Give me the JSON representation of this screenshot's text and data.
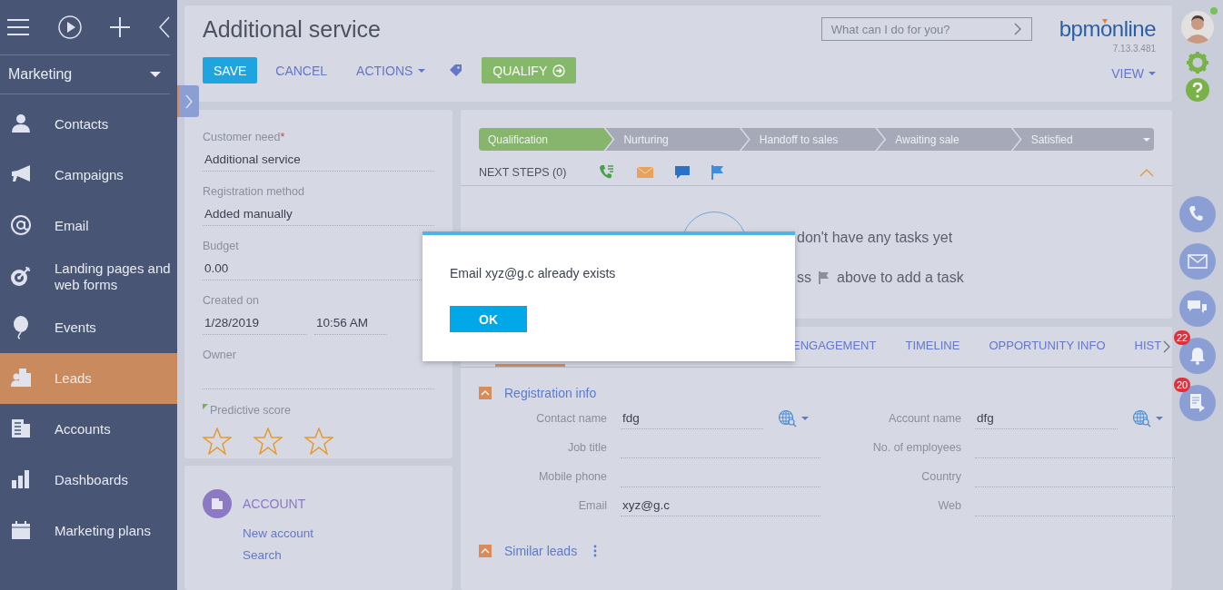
{
  "sidebar": {
    "workspace": "Marketing",
    "items": [
      {
        "label": "Contacts",
        "selected": false
      },
      {
        "label": "Campaigns",
        "selected": false
      },
      {
        "label": "Email",
        "selected": false
      },
      {
        "label": "Landing pages and web forms",
        "selected": false
      },
      {
        "label": "Events",
        "selected": false
      },
      {
        "label": "Leads",
        "selected": true
      },
      {
        "label": "Accounts",
        "selected": false
      },
      {
        "label": "Dashboards",
        "selected": false
      },
      {
        "label": "Marketing plans",
        "selected": false
      }
    ]
  },
  "header": {
    "title": "Additional service",
    "buttons": [
      {
        "kind": "primary",
        "label": "SAVE"
      },
      {
        "kind": "link",
        "label": "CANCEL"
      },
      {
        "kind": "menu",
        "label": "ACTIONS"
      },
      {
        "kind": "tag"
      },
      {
        "kind": "success",
        "label": "QUALIFY"
      }
    ],
    "search": {
      "placeholder": "What can I do for you?"
    },
    "logo": "bpmonline",
    "version": "7.13.3.481",
    "view_button": "VIEW"
  },
  "left_panel": {
    "fields": [
      {
        "label": "Customer need",
        "required_mark": "*",
        "value": "Additional service"
      },
      {
        "label": "Registration method",
        "value": "Added manually"
      },
      {
        "label": "Budget",
        "value": "0.00"
      },
      {
        "label": "Created on",
        "values": [
          "1/28/2019",
          "10:56 AM"
        ]
      },
      {
        "label": "Owner"
      }
    ],
    "predictive_score": {
      "label": "Predictive score",
      "stars": 0
    }
  },
  "account_panel": {
    "title": "ACCOUNT",
    "links": [
      "New account",
      "Search"
    ]
  },
  "stages": [
    {
      "label": "Qualification",
      "selected": true
    },
    {
      "label": "Nurturing",
      "selected": false
    },
    {
      "label": "Handoff to sales",
      "selected": false
    },
    {
      "label": "Awaiting sale",
      "selected": false
    },
    {
      "label": "Satisfied",
      "selected": false
    }
  ],
  "next_steps": {
    "label": "NEXT STEPS (0)",
    "expanded": true
  },
  "empty_state": {
    "line_1": "don't have any tasks yet",
    "line_2_start": "ss",
    "line_2_end": "above to add a task"
  },
  "tabs": [
    {
      "selected": true
    },
    {
      "label": "ENGAGEMENT",
      "selected": false
    },
    {
      "label": "TIMELINE",
      "selected": false
    },
    {
      "label": "OPPORTUNITY INFO",
      "selected": false
    },
    {
      "label": "HIST",
      "selected": false
    }
  ],
  "registration_info": {
    "title": "Registration info",
    "expanded": true,
    "fields": [
      {
        "label": "Contact name",
        "kind": "lookup",
        "value": "fdg"
      },
      {
        "label": "Account name",
        "kind": "lookup",
        "value": "dfg"
      },
      {
        "label": "Job title",
        "kind": "text"
      },
      {
        "label": "No. of employees",
        "kind": "text"
      },
      {
        "label": "Mobile phone",
        "kind": "text"
      },
      {
        "label": "Country",
        "kind": "text"
      },
      {
        "label": "Email",
        "kind": "text",
        "value": "xyz@g.c"
      },
      {
        "label": "Web",
        "kind": "text"
      }
    ]
  },
  "similar_leads": {
    "title": "Similar leads",
    "expanded": true
  },
  "rail": {
    "notifications_count": "22",
    "feed_count": "20"
  },
  "modal": {
    "message": "Email xyz@g.c already exists",
    "button": "OK"
  }
}
